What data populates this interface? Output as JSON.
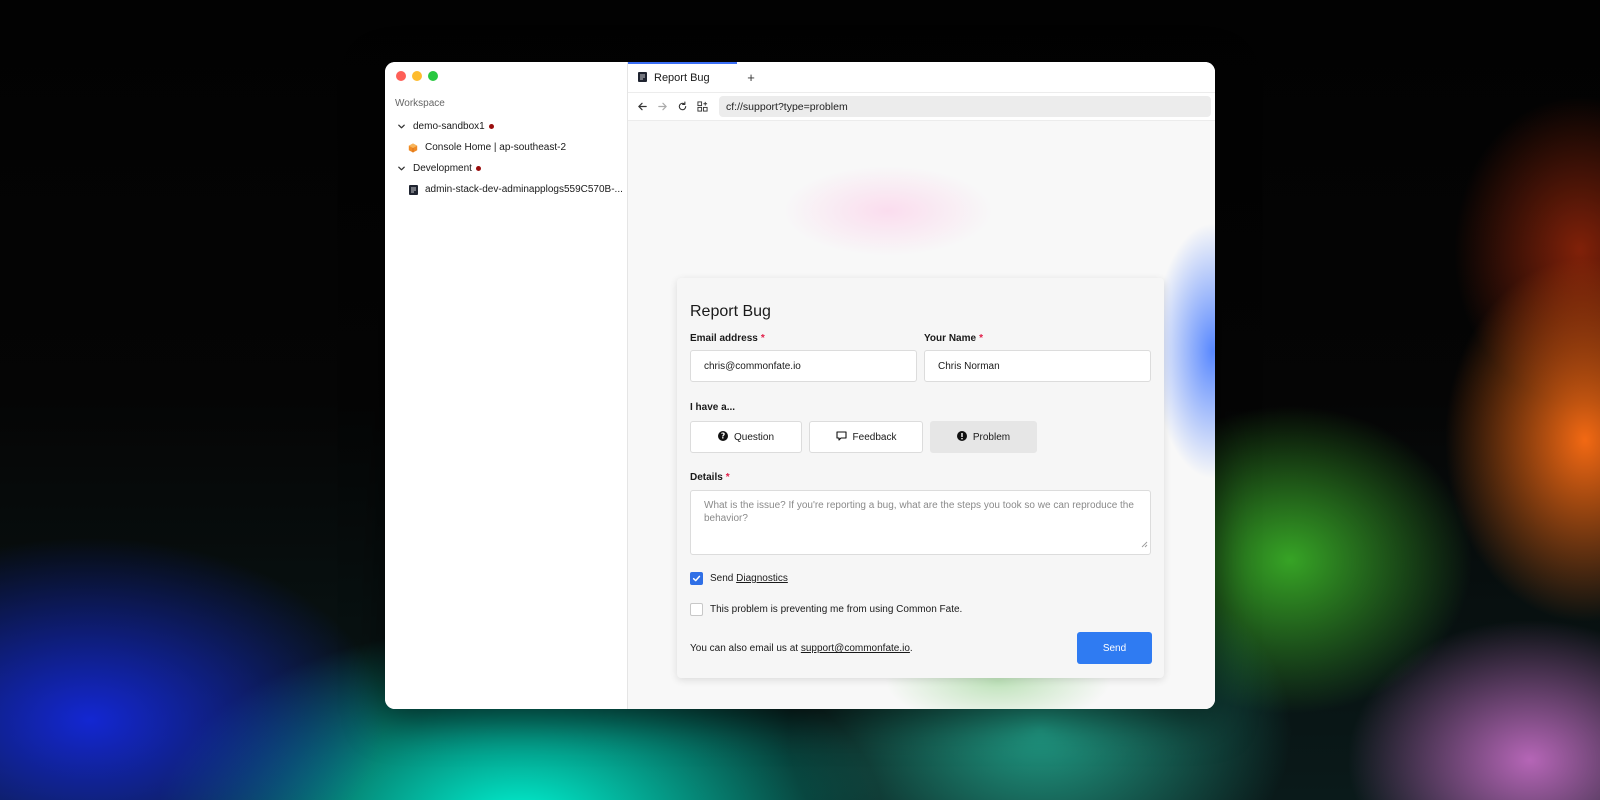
{
  "sidebar": {
    "workspace_label": "Workspace",
    "tree": [
      {
        "label": "demo-sandbox1",
        "status_color": "#9a0d0d"
      },
      {
        "label": "Console Home | ap-southeast-2",
        "icon": "aws-cube-icon"
      },
      {
        "label": "Development",
        "status_color": "#9a0d0d"
      },
      {
        "label": "admin-stack-dev-adminapplogs559C570B-...",
        "icon": "document-icon"
      }
    ]
  },
  "tabbar": {
    "tabs": [
      {
        "label": "Report Bug",
        "active": true
      }
    ],
    "add_label": "+"
  },
  "navbar": {
    "url": "cf://support?type=problem"
  },
  "form": {
    "title": "Report Bug",
    "email_label": "Email address",
    "email_value": "chris@commonfate.io",
    "name_label": "Your Name",
    "name_value": "Chris Norman",
    "required_mark": "*",
    "type_label": "I have a...",
    "type_options": [
      {
        "label": "Question",
        "icon": "question-circle-icon",
        "selected": false
      },
      {
        "label": "Feedback",
        "icon": "speech-bubble-icon",
        "selected": false
      },
      {
        "label": "Problem",
        "icon": "exclamation-circle-icon",
        "selected": true
      }
    ],
    "details_label": "Details",
    "details_placeholder": "What is the issue? If you're reporting a bug, what are the steps you took so we can reproduce the behavior?",
    "diagnostics_prefix": "Send",
    "diagnostics_link": "Diagnostics",
    "diagnostics_checked": true,
    "blocking_label": "This problem is preventing me from using Common Fate.",
    "blocking_checked": false,
    "footer_prefix": "You can also email us at",
    "footer_email": "support@commonfate.io",
    "footer_suffix": ".",
    "send_label": "Send"
  },
  "colors": {
    "accent": "#2f7bf2",
    "active_tab": "#3b6ff5",
    "required": "#e11d48",
    "status_dot": "#9a0d0d"
  }
}
